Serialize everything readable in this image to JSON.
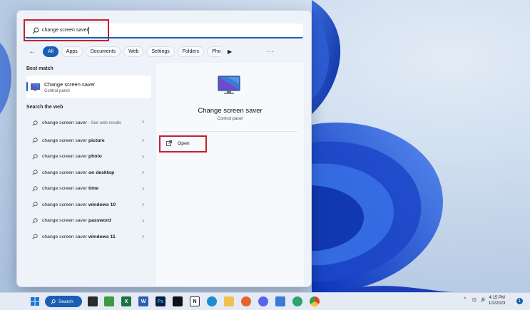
{
  "search": {
    "value": "change screen saver"
  },
  "filters": {
    "chips": [
      {
        "label": "All",
        "active": true
      },
      {
        "label": "Apps",
        "active": false
      },
      {
        "label": "Documents",
        "active": false
      },
      {
        "label": "Web",
        "active": false
      },
      {
        "label": "Settings",
        "active": false
      },
      {
        "label": "Folders",
        "active": false
      },
      {
        "label": "Pho",
        "active": false
      }
    ],
    "more_label": "···"
  },
  "best_match": {
    "heading": "Best match",
    "title": "Change screen saver",
    "subtitle": "Control panel"
  },
  "web": {
    "heading": "Search the web",
    "items": [
      {
        "prefix": "change screen saver",
        "bold": "",
        "suffix": " - See web results"
      },
      {
        "prefix": "change screen saver ",
        "bold": "picture",
        "suffix": ""
      },
      {
        "prefix": "change screen saver ",
        "bold": "photo",
        "suffix": ""
      },
      {
        "prefix": "change screen saver ",
        "bold": "on desktop",
        "suffix": ""
      },
      {
        "prefix": "change screen saver ",
        "bold": "time",
        "suffix": ""
      },
      {
        "prefix": "change screen saver ",
        "bold": "windows 10",
        "suffix": ""
      },
      {
        "prefix": "change screen saver ",
        "bold": "password",
        "suffix": ""
      },
      {
        "prefix": "change screen saver ",
        "bold": "windows 11",
        "suffix": ""
      }
    ]
  },
  "preview": {
    "title": "Change screen saver",
    "subtitle": "Control panel",
    "open_label": "Open"
  },
  "taskbar": {
    "search_label": "Search",
    "time": "4:15 PM",
    "date": "1/2/2023",
    "notification_count": "1",
    "pinned": [
      {
        "name": "file-explorer-dark-icon",
        "glyph": "",
        "color": "#2b2b2b"
      },
      {
        "name": "plant-app-icon",
        "glyph": "",
        "color": "#3c9b3c"
      },
      {
        "name": "excel-icon",
        "glyph": "X",
        "color": "#1d7044"
      },
      {
        "name": "word-icon",
        "glyph": "W",
        "color": "#2b5fb4"
      },
      {
        "name": "photoshop-icon",
        "glyph": "Ps",
        "color": "#0a1f3d"
      },
      {
        "name": "app-black-icon",
        "glyph": "",
        "color": "#111111"
      },
      {
        "name": "notion-icon",
        "glyph": "N",
        "color": "#ffffff"
      },
      {
        "name": "edge-icon",
        "glyph": "",
        "color": "#1e8bd1"
      },
      {
        "name": "file-explorer-icon",
        "glyph": "",
        "color": "#f2c14e"
      },
      {
        "name": "firefox-icon",
        "glyph": "",
        "color": "#e8622a"
      },
      {
        "name": "discord-icon",
        "glyph": "",
        "color": "#5865f2"
      },
      {
        "name": "remote-desktop-icon",
        "glyph": "",
        "color": "#3a7bd5"
      },
      {
        "name": "maps-icon",
        "glyph": "",
        "color": "#2fa36b"
      },
      {
        "name": "chrome-icon",
        "glyph": "",
        "color": "#e44134"
      }
    ],
    "tray": [
      "^",
      "⊡",
      "🔊"
    ]
  },
  "colors": {
    "accent": "#1a5fb4",
    "highlight_box": "#c5202f"
  }
}
